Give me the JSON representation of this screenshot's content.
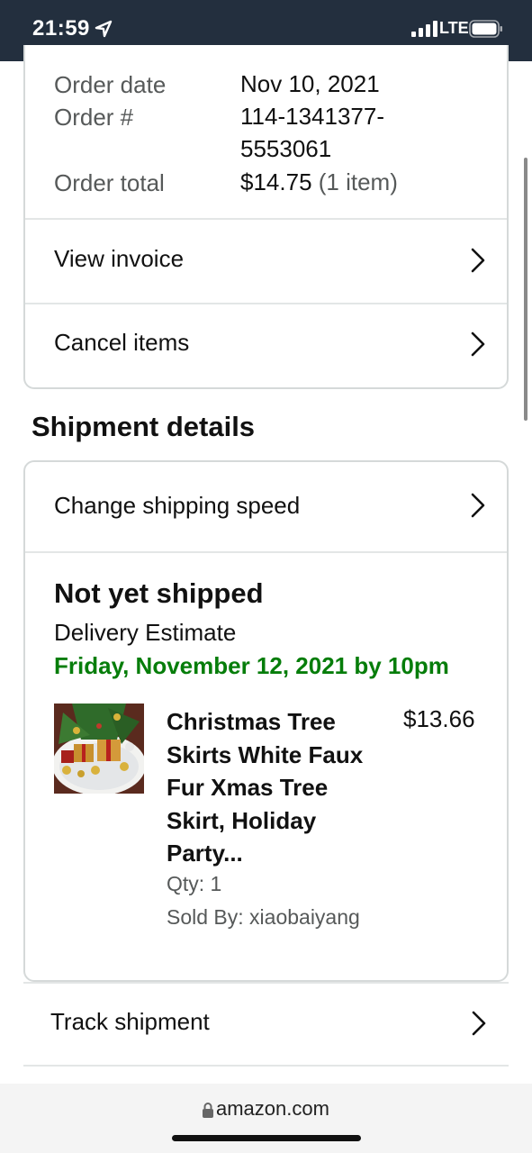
{
  "status_bar": {
    "time": "21:59",
    "network": "LTE"
  },
  "order_info": {
    "rows": [
      {
        "label": "Order date",
        "value": "Nov 10, 2021"
      },
      {
        "label": "Order #",
        "value_line1": "114-1341377-",
        "value_line2": "5553061"
      },
      {
        "label": "Order total",
        "value": "$14.75",
        "suffix": " (1 item)"
      }
    ],
    "actions": [
      {
        "label": "View invoice"
      },
      {
        "label": "Cancel items"
      }
    ]
  },
  "shipment": {
    "section_title": "Shipment details",
    "change_speed_label": "Change shipping speed",
    "status": "Not yet shipped",
    "delivery_label": "Delivery Estimate",
    "delivery_date": "Friday, November 12, 2021 by 10pm",
    "item": {
      "title_lines": [
        "Christmas Tree",
        "Skirts White Faux",
        "Fur Xmas Tree",
        "Skirt, Holiday",
        "Party..."
      ],
      "price": "$13.66",
      "qty": "Qty: 1",
      "sold_by": "Sold By: xiaobaiyang"
    },
    "track_label": "Track shipment"
  },
  "browser": {
    "url": "amazon.com"
  },
  "colors": {
    "header_bg": "#232f3e",
    "delivery_green": "#067d0a",
    "border": "#d5d9d9"
  }
}
